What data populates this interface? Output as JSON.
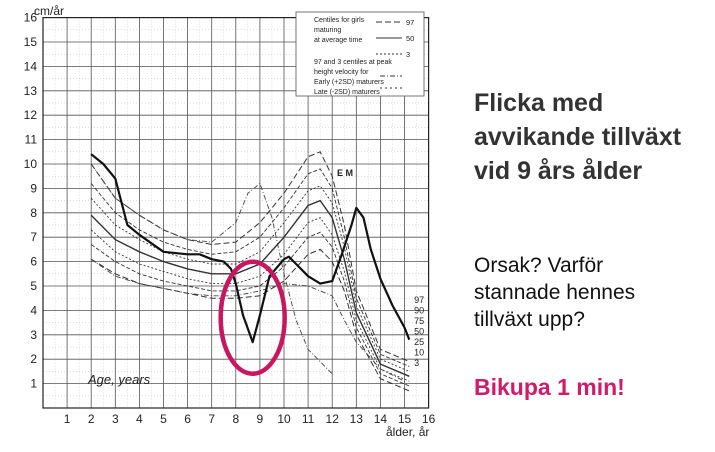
{
  "slide": {
    "title_lines": [
      "Flicka med",
      "avvikande tillväxt",
      "vid 9 års ålder"
    ],
    "question_lines": [
      "Orsak? Varför",
      "stannade hennes",
      "tillväxt upp?"
    ],
    "task": "Bikupa 1 min!",
    "accent_color": "#d01a6a"
  },
  "chart_data": {
    "type": "line",
    "ylabel": "cm/år",
    "xlabel": "ålder, år",
    "inner_label": "Age, years",
    "xlim": [
      0,
      16
    ],
    "ylim": [
      0,
      16
    ],
    "x_ticks": [
      "1",
      "2",
      "3",
      "4",
      "5",
      "6",
      "7",
      "8",
      "9",
      "10",
      "11",
      "12",
      "13",
      "14",
      "15",
      "16"
    ],
    "y_ticks": [
      "1",
      "2",
      "3",
      "4",
      "5",
      "6",
      "7",
      "8",
      "9",
      "10",
      "11",
      "12",
      "13",
      "14",
      "15",
      "16"
    ],
    "grid": true,
    "legend": {
      "position": "top-right",
      "lines": [
        "Centiles for girls",
        "maturing",
        "at average time",
        "97 and 3 centiles at peak",
        "height velocity for",
        "Early (+2SD) maturers",
        "Late (-2SD) maturers"
      ],
      "centile_labels": [
        "97",
        "50",
        "3"
      ]
    },
    "percentile_labels": [
      "97",
      "90",
      "75",
      "50",
      "25",
      "10",
      "3"
    ],
    "peak_labels": [
      "E",
      "M"
    ],
    "highlight_color": "#c8175f",
    "series": [
      {
        "name": "97",
        "x": [
          2,
          3,
          4,
          5,
          6,
          7,
          8,
          9,
          10,
          11,
          11.5,
          12,
          12.5,
          13,
          14,
          15.2
        ],
        "y": [
          10.0,
          8.6,
          7.9,
          7.3,
          6.9,
          6.7,
          6.8,
          7.6,
          8.8,
          10.3,
          10.5,
          9.5,
          7.5,
          4.8,
          2.4,
          1.9
        ]
      },
      {
        "name": "90",
        "x": [
          2,
          3,
          4,
          5,
          6,
          7,
          8,
          9,
          10,
          11,
          11.5,
          12,
          12.5,
          13,
          14,
          15.2
        ],
        "y": [
          9.2,
          8.0,
          7.3,
          6.8,
          6.5,
          6.3,
          6.4,
          7.0,
          8.2,
          9.6,
          9.8,
          9.0,
          7.0,
          4.5,
          2.2,
          1.7
        ]
      },
      {
        "name": "75",
        "x": [
          2,
          3,
          4,
          5,
          6,
          7,
          8,
          9,
          10,
          11,
          11.5,
          12,
          12.5,
          13,
          14,
          15.2
        ],
        "y": [
          8.6,
          7.5,
          6.9,
          6.4,
          6.1,
          5.9,
          5.9,
          6.4,
          7.6,
          8.9,
          9.1,
          8.4,
          6.6,
          4.2,
          2.0,
          1.5
        ]
      },
      {
        "name": "50",
        "x": [
          2,
          3,
          4,
          5,
          6,
          7,
          8,
          9,
          10,
          11,
          11.5,
          12,
          12.5,
          13,
          14,
          15.2
        ],
        "y": [
          7.9,
          6.9,
          6.4,
          6.0,
          5.7,
          5.5,
          5.5,
          5.9,
          7.0,
          8.3,
          8.5,
          7.8,
          6.1,
          3.9,
          1.8,
          1.3
        ]
      },
      {
        "name": "25",
        "x": [
          2,
          3,
          4,
          5,
          6,
          7,
          8,
          9,
          10,
          11,
          11.5,
          12,
          12.5,
          13,
          14,
          15.2
        ],
        "y": [
          7.3,
          6.4,
          5.9,
          5.6,
          5.3,
          5.1,
          5.1,
          5.4,
          6.3,
          7.6,
          7.8,
          7.1,
          5.6,
          3.6,
          1.6,
          1.1
        ]
      },
      {
        "name": "10",
        "x": [
          2,
          3,
          4,
          5,
          6,
          7,
          8,
          9,
          10,
          11,
          11.5,
          12,
          12.5,
          13,
          14,
          15.2
        ],
        "y": [
          6.7,
          6.0,
          5.5,
          5.2,
          5.0,
          4.8,
          4.8,
          5.0,
          5.8,
          7.0,
          7.2,
          6.6,
          5.2,
          3.3,
          1.4,
          0.9
        ]
      },
      {
        "name": "3",
        "x": [
          2,
          3,
          4,
          5,
          6,
          7,
          8,
          9,
          10,
          11,
          11.5,
          12,
          12.5,
          13,
          14,
          15.2
        ],
        "y": [
          6.1,
          5.5,
          5.1,
          4.9,
          4.7,
          4.5,
          4.5,
          4.6,
          5.2,
          6.3,
          6.5,
          6.0,
          4.8,
          3.0,
          1.2,
          0.7
        ]
      },
      {
        "x": [
          2,
          2.5,
          3,
          3.5,
          4,
          5,
          6,
          6.5,
          7,
          7.5,
          7.8,
          8,
          8.3,
          8.7,
          9.0,
          9.4,
          10,
          10.2,
          10.5,
          11,
          11.5,
          12,
          12.4,
          12.8,
          13.0,
          13.3,
          13.6,
          14.0,
          14.5,
          15.0,
          15.2
        ],
        "y": [
          10.4,
          10.0,
          9.4,
          7.5,
          7.1,
          6.4,
          6.3,
          6.3,
          6.1,
          6.0,
          5.7,
          5.1,
          3.8,
          2.7,
          3.8,
          5.4,
          6.1,
          6.2,
          5.9,
          5.4,
          5.1,
          5.2,
          6.3,
          7.5,
          8.2,
          7.8,
          6.5,
          5.3,
          4.2,
          3.3,
          2.8
        ]
      },
      {
        "x": [
          2,
          3,
          4,
          5,
          6,
          7,
          8,
          9,
          10,
          11,
          12,
          12.5,
          13,
          14,
          15
        ],
        "y": [
          6.1,
          5.4,
          5.1,
          4.9,
          4.7,
          4.6,
          4.6,
          4.8,
          5.1,
          5.0,
          4.6,
          3.6,
          2.7,
          1.6,
          1.1
        ]
      },
      {
        "x": [
          2,
          3,
          4,
          5,
          6,
          7,
          8,
          8.5,
          9,
          9.5,
          10,
          10.5,
          11,
          12
        ],
        "y": [
          10.0,
          8.6,
          7.9,
          7.3,
          6.9,
          6.8,
          7.6,
          8.8,
          9.2,
          7.8,
          5.5,
          3.6,
          2.4,
          1.4
        ]
      }
    ]
  }
}
